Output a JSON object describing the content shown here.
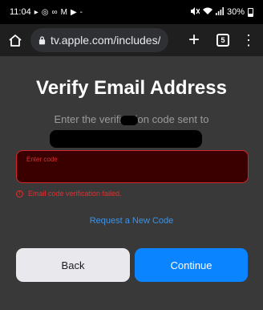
{
  "status_bar": {
    "time": "11:04",
    "app_icons": [
      "▸",
      "◎",
      "∞",
      "M",
      "▶",
      "-"
    ],
    "battery": "30%"
  },
  "browser": {
    "url": "tv.apple.com/includes/co",
    "tab_count": "5"
  },
  "page": {
    "title": "Verify Email Address",
    "subtitle": "Enter the verification code sent to",
    "code_field": {
      "placeholder": "Enter code",
      "value": ""
    },
    "error_message": "Email code verification failed.",
    "request_link": "Request a New Code",
    "back_label": "Back",
    "continue_label": "Continue"
  },
  "colors": {
    "page_bg": "#393939",
    "error": "#e0302f",
    "link": "#3b93e8",
    "primary": "#0a84ff",
    "secondary": "#e8e8ed"
  }
}
